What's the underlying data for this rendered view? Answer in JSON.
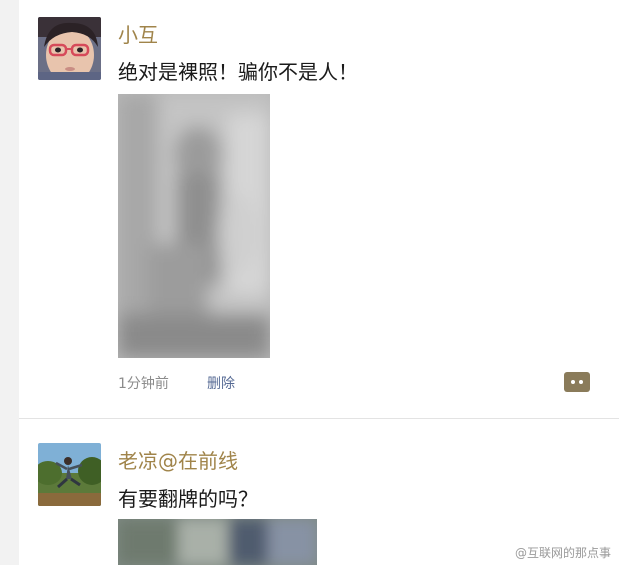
{
  "posts": [
    {
      "username": "小互",
      "text": "绝对是裸照！骗你不是人！",
      "time": "1分钟前",
      "delete_label": "删除",
      "icons": {
        "avatar": "girl-with-glasses-avatar",
        "photo": "blurred-photo",
        "comment": "comment-bubble-icon"
      }
    },
    {
      "username": "老凉@在前线",
      "text": "有要翻牌的吗？",
      "icons": {
        "avatar": "outdoor-jump-avatar",
        "photo": "blurred-photo"
      }
    }
  ],
  "watermark": "@互联网的那点事",
  "colors": {
    "username": "#a0844a",
    "link": "#576b95",
    "meta": "#8c8c8c",
    "comment_button": "#8a7b5a",
    "background": "#f2f2f2"
  }
}
